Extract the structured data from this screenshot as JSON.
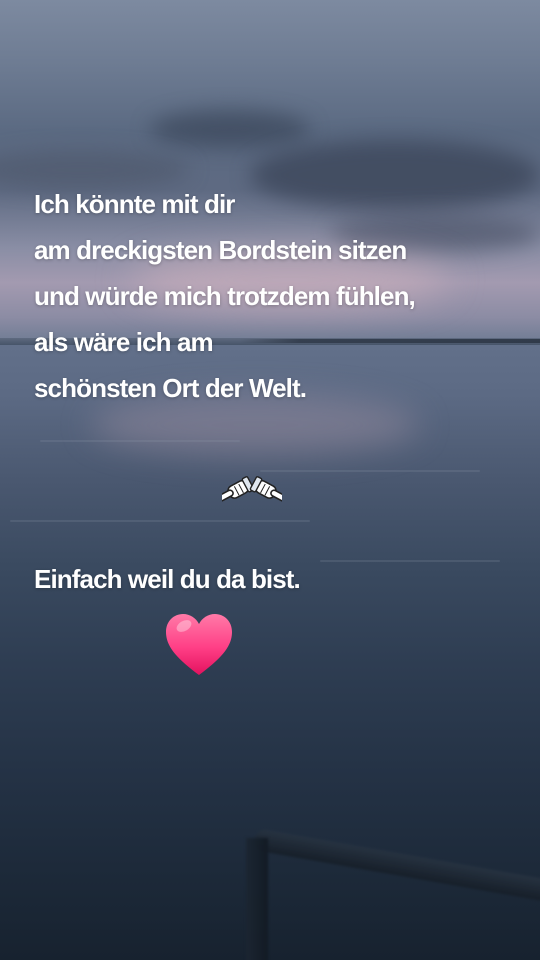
{
  "caption": {
    "lines": [
      "Ich könnte mit dir",
      "am dreckigsten Bordstein sitzen",
      "und würde mich trotzdem fühlen,",
      "als wäre ich am",
      "schönsten Ort der Welt."
    ],
    "closing": "Einfach weil du da bist."
  },
  "icons": {
    "hands": "pointing-hands-icon",
    "heart": "pink-heart-icon"
  },
  "colors": {
    "text": "#ffffff",
    "heart": "#ff3f86"
  }
}
